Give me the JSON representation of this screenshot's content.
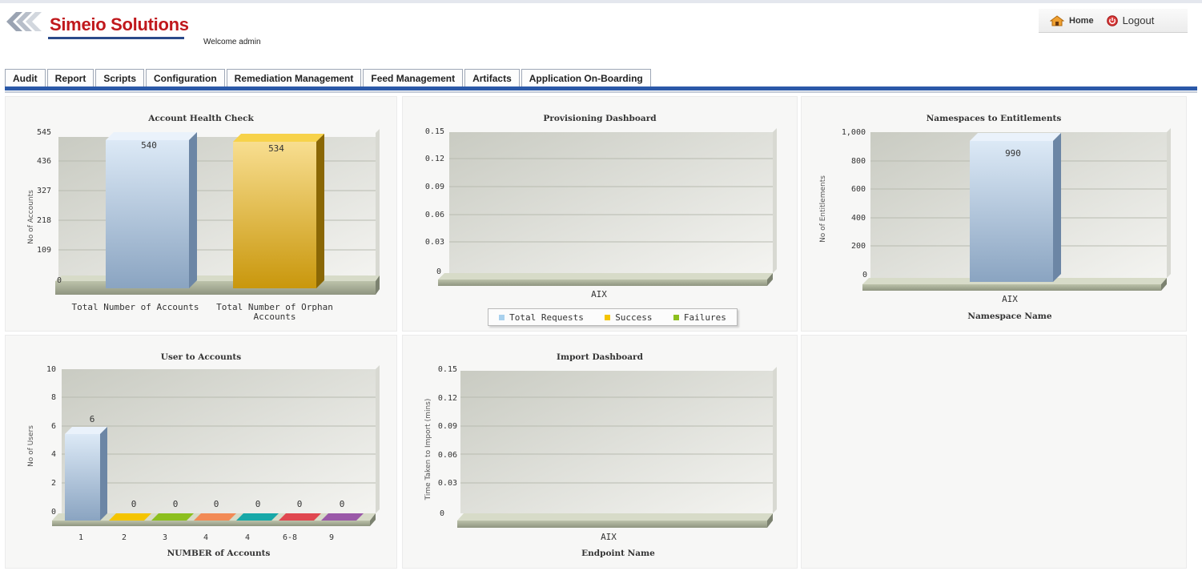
{
  "header": {
    "brand_name": "Simeio Solutions",
    "welcome_text": "Welcome admin",
    "home_label": "Home",
    "home_icon": "home-icon",
    "logout_label": "Logout",
    "logout_icon": "power-icon"
  },
  "nav": {
    "tabs": [
      "Audit",
      "Report",
      "Scripts",
      "Configuration",
      "Remediation Management",
      "Feed Management",
      "Artifacts",
      "Application On-Boarding"
    ]
  },
  "colors": {
    "brand_red": "#c0181c",
    "tabbar_blue": "#2b59a8",
    "bar_blue": "#aec3da",
    "bar_gold": "#e7b21c",
    "legend_blue": "#a9d1ee",
    "legend_gold": "#f4c400",
    "legend_green": "#8cbf1e"
  },
  "charts": {
    "account_health": {
      "title": "Account Health Check",
      "ylabel": "No of Accounts",
      "yticks": [
        "0",
        "109",
        "218",
        "327",
        "436",
        "545"
      ]
    },
    "provisioning": {
      "title": "Provisioning Dashboard",
      "yticks": [
        "0",
        "0.03",
        "0.06",
        "0.09",
        "0.12",
        "0.15"
      ],
      "category": "AIX",
      "legend": [
        "Total Requests",
        "Success",
        "Failures"
      ]
    },
    "namespaces": {
      "title": "Namespaces to Entitlements",
      "ylabel": "No of Entitlements",
      "yticks": [
        "0",
        "200",
        "400",
        "600",
        "800",
        "1,000"
      ],
      "category": "AIX",
      "xlabel": "Namespace Name"
    },
    "user_accounts": {
      "title": "User to Accounts",
      "ylabel": "No of Users",
      "yticks": [
        "0",
        "2",
        "4",
        "6",
        "8",
        "10"
      ],
      "xlabel": "NUMBER of Accounts"
    },
    "import": {
      "title": "Import Dashboard",
      "ylabel": "Time Taken to Import (mins)",
      "yticks": [
        "0",
        "0.03",
        "0.06",
        "0.09",
        "0.12",
        "0.15"
      ],
      "category": "AIX",
      "xlabel": "Endpoint Name"
    }
  },
  "chart_data": [
    {
      "type": "bar",
      "title": "Account Health Check",
      "categories": [
        "Total Number of Accounts",
        "Total Number of Orphan Accounts"
      ],
      "values": [
        540,
        534
      ],
      "ylabel": "No of Accounts",
      "ylim": [
        0,
        545
      ],
      "yticks": [
        0,
        109,
        218,
        327,
        436,
        545
      ]
    },
    {
      "type": "bar",
      "title": "Provisioning Dashboard",
      "categories": [
        "AIX"
      ],
      "series": [
        {
          "name": "Total Requests",
          "values": [
            0
          ]
        },
        {
          "name": "Success",
          "values": [
            0
          ]
        },
        {
          "name": "Failures",
          "values": [
            0
          ]
        }
      ],
      "ylim": [
        0,
        0.15
      ],
      "yticks": [
        0,
        0.03,
        0.06,
        0.09,
        0.12,
        0.15
      ],
      "legend": "bottom"
    },
    {
      "type": "bar",
      "title": "Namespaces to Entitlements",
      "categories": [
        "AIX"
      ],
      "values": [
        990
      ],
      "xlabel": "Namespace Name",
      "ylabel": "No of Entitlements",
      "ylim": [
        0,
        1000
      ],
      "yticks": [
        0,
        200,
        400,
        600,
        800,
        1000
      ]
    },
    {
      "type": "bar",
      "title": "User to Accounts",
      "categories": [
        "1",
        "2",
        "3",
        "4",
        "4",
        "6-8",
        "9"
      ],
      "values": [
        6,
        0,
        0,
        0,
        0,
        0,
        0
      ],
      "xlabel": "NUMBER of Accounts",
      "ylabel": "No of Users",
      "ylim": [
        0,
        10
      ],
      "yticks": [
        0,
        2,
        4,
        6,
        8,
        10
      ]
    },
    {
      "type": "bar",
      "title": "Import Dashboard",
      "categories": [
        "AIX"
      ],
      "values": [],
      "xlabel": "Endpoint Name",
      "ylabel": "Time Taken to Import (mins)",
      "ylim": [
        0,
        0.15
      ],
      "yticks": [
        0,
        0.03,
        0.06,
        0.09,
        0.12,
        0.15
      ]
    }
  ]
}
